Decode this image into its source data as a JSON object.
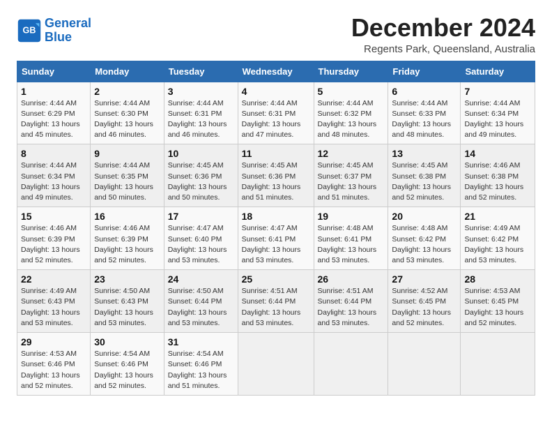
{
  "logo": {
    "line1": "General",
    "line2": "Blue"
  },
  "title": "December 2024",
  "subtitle": "Regents Park, Queensland, Australia",
  "days_of_week": [
    "Sunday",
    "Monday",
    "Tuesday",
    "Wednesday",
    "Thursday",
    "Friday",
    "Saturday"
  ],
  "weeks": [
    [
      {
        "day": "1",
        "sunrise": "4:44 AM",
        "sunset": "6:29 PM",
        "daylight": "13 hours and 45 minutes."
      },
      {
        "day": "2",
        "sunrise": "4:44 AM",
        "sunset": "6:30 PM",
        "daylight": "13 hours and 46 minutes."
      },
      {
        "day": "3",
        "sunrise": "4:44 AM",
        "sunset": "6:31 PM",
        "daylight": "13 hours and 46 minutes."
      },
      {
        "day": "4",
        "sunrise": "4:44 AM",
        "sunset": "6:31 PM",
        "daylight": "13 hours and 47 minutes."
      },
      {
        "day": "5",
        "sunrise": "4:44 AM",
        "sunset": "6:32 PM",
        "daylight": "13 hours and 48 minutes."
      },
      {
        "day": "6",
        "sunrise": "4:44 AM",
        "sunset": "6:33 PM",
        "daylight": "13 hours and 48 minutes."
      },
      {
        "day": "7",
        "sunrise": "4:44 AM",
        "sunset": "6:34 PM",
        "daylight": "13 hours and 49 minutes."
      }
    ],
    [
      {
        "day": "8",
        "sunrise": "4:44 AM",
        "sunset": "6:34 PM",
        "daylight": "13 hours and 49 minutes."
      },
      {
        "day": "9",
        "sunrise": "4:44 AM",
        "sunset": "6:35 PM",
        "daylight": "13 hours and 50 minutes."
      },
      {
        "day": "10",
        "sunrise": "4:45 AM",
        "sunset": "6:36 PM",
        "daylight": "13 hours and 50 minutes."
      },
      {
        "day": "11",
        "sunrise": "4:45 AM",
        "sunset": "6:36 PM",
        "daylight": "13 hours and 51 minutes."
      },
      {
        "day": "12",
        "sunrise": "4:45 AM",
        "sunset": "6:37 PM",
        "daylight": "13 hours and 51 minutes."
      },
      {
        "day": "13",
        "sunrise": "4:45 AM",
        "sunset": "6:38 PM",
        "daylight": "13 hours and 52 minutes."
      },
      {
        "day": "14",
        "sunrise": "4:46 AM",
        "sunset": "6:38 PM",
        "daylight": "13 hours and 52 minutes."
      }
    ],
    [
      {
        "day": "15",
        "sunrise": "4:46 AM",
        "sunset": "6:39 PM",
        "daylight": "13 hours and 52 minutes."
      },
      {
        "day": "16",
        "sunrise": "4:46 AM",
        "sunset": "6:39 PM",
        "daylight": "13 hours and 52 minutes."
      },
      {
        "day": "17",
        "sunrise": "4:47 AM",
        "sunset": "6:40 PM",
        "daylight": "13 hours and 53 minutes."
      },
      {
        "day": "18",
        "sunrise": "4:47 AM",
        "sunset": "6:41 PM",
        "daylight": "13 hours and 53 minutes."
      },
      {
        "day": "19",
        "sunrise": "4:48 AM",
        "sunset": "6:41 PM",
        "daylight": "13 hours and 53 minutes."
      },
      {
        "day": "20",
        "sunrise": "4:48 AM",
        "sunset": "6:42 PM",
        "daylight": "13 hours and 53 minutes."
      },
      {
        "day": "21",
        "sunrise": "4:49 AM",
        "sunset": "6:42 PM",
        "daylight": "13 hours and 53 minutes."
      }
    ],
    [
      {
        "day": "22",
        "sunrise": "4:49 AM",
        "sunset": "6:43 PM",
        "daylight": "13 hours and 53 minutes."
      },
      {
        "day": "23",
        "sunrise": "4:50 AM",
        "sunset": "6:43 PM",
        "daylight": "13 hours and 53 minutes."
      },
      {
        "day": "24",
        "sunrise": "4:50 AM",
        "sunset": "6:44 PM",
        "daylight": "13 hours and 53 minutes."
      },
      {
        "day": "25",
        "sunrise": "4:51 AM",
        "sunset": "6:44 PM",
        "daylight": "13 hours and 53 minutes."
      },
      {
        "day": "26",
        "sunrise": "4:51 AM",
        "sunset": "6:44 PM",
        "daylight": "13 hours and 53 minutes."
      },
      {
        "day": "27",
        "sunrise": "4:52 AM",
        "sunset": "6:45 PM",
        "daylight": "13 hours and 52 minutes."
      },
      {
        "day": "28",
        "sunrise": "4:53 AM",
        "sunset": "6:45 PM",
        "daylight": "13 hours and 52 minutes."
      }
    ],
    [
      {
        "day": "29",
        "sunrise": "4:53 AM",
        "sunset": "6:46 PM",
        "daylight": "13 hours and 52 minutes."
      },
      {
        "day": "30",
        "sunrise": "4:54 AM",
        "sunset": "6:46 PM",
        "daylight": "13 hours and 52 minutes."
      },
      {
        "day": "31",
        "sunrise": "4:54 AM",
        "sunset": "6:46 PM",
        "daylight": "13 hours and 51 minutes."
      },
      null,
      null,
      null,
      null
    ]
  ]
}
